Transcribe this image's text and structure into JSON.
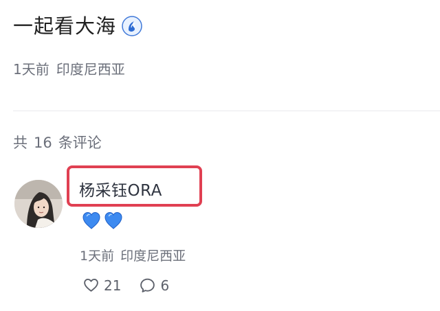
{
  "post": {
    "title": "一起看大海",
    "title_icon": "wave-icon",
    "time": "1天前",
    "location": "印度尼西亚"
  },
  "comments": {
    "count_prefix": "共",
    "count": "16",
    "count_suffix": "条评论",
    "item": {
      "author": "杨采钰ORA",
      "author_highlight_color": "#e04052",
      "reaction_icon": "blue-heart-icon",
      "time": "1天前",
      "location": "印度尼西亚",
      "likes": "21",
      "replies": "6"
    }
  },
  "colors": {
    "meta": "#6b6f7a",
    "heart": "#3d8af0",
    "icon": "#5d616b"
  }
}
